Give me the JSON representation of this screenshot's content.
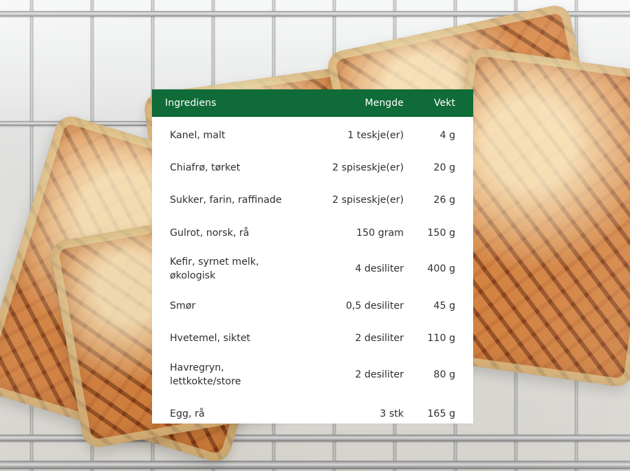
{
  "table": {
    "headers": {
      "ingredient": "Ingrediens",
      "amount": "Mengde",
      "weight": "Vekt"
    },
    "rows": [
      {
        "ingredient": "Kanel, malt",
        "amount": "1 teskje(er)",
        "weight": "4 g"
      },
      {
        "ingredient": "Chiafrø, tørket",
        "amount": "2 spiseskje(er)",
        "weight": "20 g"
      },
      {
        "ingredient": "Sukker, farin, raffinade",
        "amount": "2 spiseskje(er)",
        "weight": "26 g"
      },
      {
        "ingredient": "Gulrot, norsk, rå",
        "amount": "150 gram",
        "weight": "150 g"
      },
      {
        "ingredient": "Kefir, syrnet melk, økologisk",
        "amount": "4 desiliter",
        "weight": "400 g"
      },
      {
        "ingredient": "Smør",
        "amount": "0,5 desiliter",
        "weight": "45 g"
      },
      {
        "ingredient": "Hvetemel, siktet",
        "amount": "2 desiliter",
        "weight": "110 g"
      },
      {
        "ingredient": "Havregryn, lettkokte/store",
        "amount": "2 desiliter",
        "weight": "80 g"
      },
      {
        "ingredient": "Egg, rå",
        "amount": "3 stk",
        "weight": "165 g"
      }
    ]
  },
  "colors": {
    "header_background": "#0f6b37",
    "header_text": "#ffffff",
    "table_background": "#ffffff",
    "body_text": "#2e2e2e"
  }
}
